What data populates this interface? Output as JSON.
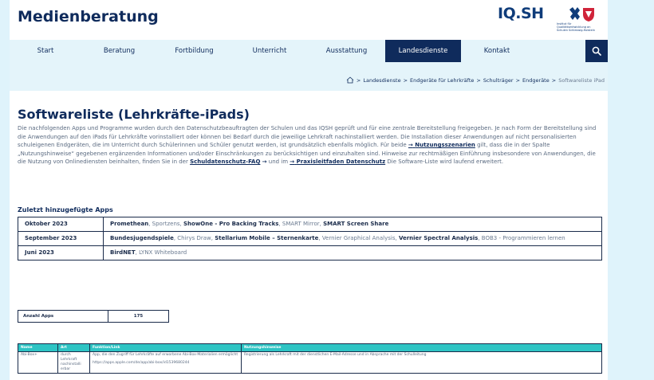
{
  "site": {
    "title": "Medienberatung",
    "logo_text": "IQ.SH",
    "logo_sub": "Institut für Qualitätsentwicklung an Schulen Schleswig-Holstein"
  },
  "nav": {
    "items": [
      {
        "label": "Start",
        "active": false
      },
      {
        "label": "Beratung",
        "active": false
      },
      {
        "label": "Fortbildung",
        "active": false
      },
      {
        "label": "Unterricht",
        "active": false
      },
      {
        "label": "Ausstattung",
        "active": false
      },
      {
        "label": "Landesdienste",
        "active": true
      },
      {
        "label": "Kontakt",
        "active": false
      }
    ],
    "search_icon": "search-icon"
  },
  "breadcrumb": {
    "items": [
      "Landesdienste",
      "Endgeräte für Lehrkräfte",
      "Schulträger",
      "Endgeräte"
    ],
    "current": "Softwareliste iPad",
    "separator": ">"
  },
  "page": {
    "title": "Softwareliste (Lehrkräfte-iPads)",
    "intro_1": "Die nachfolgenden Apps und Programme wurden durch den Datenschutzbeauftragten der Schulen und das IQSH geprüft und für eine zentrale Bereitstellung freigegeben. Je nach Form der Bereitstellung sind die Anwendungen auf den iPads für Lehrkräfte vorinstalliert oder können bei Bedarf durch die jeweilige Lehrkraft nachinstalliert werden. Die Installation dieser Anwendungen auf nicht personalisierten schuleigenen Endgeräten, die im Unterricht durch Schülerinnen und Schüler genutzt werden, ist grundsätzlich ebenfalls möglich. Für beide ",
    "link_1": "Nutzungsszenarien",
    "intro_2": " gilt, dass die in der Spalte „Nutzungshinweise“ gegebenen ergänzenden Informationen und/oder Einschränkungen zu berücksichtigen und einzuhalten sind. Hinweise zur rechtmäßigen Einführung insbesondere von Anwendungen, die die Nutzung von Onlinediensten beinhalten, finden Sie in der ",
    "link_2": "Schuldatenschutz-FAQ",
    "intro_3": " und im ",
    "link_3": "Praxisleitfaden Datenschutz",
    "intro_4": " Die Software-Liste wird laufend erweitert.",
    "link_arrow": "→"
  },
  "recent": {
    "title": "Zuletzt hinzugefügte Apps",
    "rows": [
      {
        "month": "Oktober 2023",
        "apps": [
          {
            "name": "Promethean",
            "bold": true,
            "sep": ", "
          },
          {
            "name": "Sportzens",
            "bold": false,
            "sep": ", "
          },
          {
            "name": "ShowOne - Pro Backing Tracks",
            "bold": true,
            "sep": ", "
          },
          {
            "name": "SMART Mirror",
            "bold": false,
            "sep": ", "
          },
          {
            "name": "SMART Screen Share",
            "bold": true,
            "sep": ""
          }
        ]
      },
      {
        "month": "September 2023",
        "apps": [
          {
            "name": "Bundesjugendspiele",
            "bold": true,
            "sep": ", "
          },
          {
            "name": "Chirys Draw",
            "bold": false,
            "sep": ", "
          },
          {
            "name": "Stellarium Mobile – Sternenkarte",
            "bold": true,
            "sep": ", "
          },
          {
            "name": "Vernier Graphical Analysis",
            "bold": false,
            "sep": ", "
          },
          {
            "name": "Vernier Spectral Analysis",
            "bold": true,
            "sep": ", "
          },
          {
            "name": "BOB3 - Programmieren lernen",
            "bold": false,
            "sep": ""
          }
        ]
      },
      {
        "month": "Juni 2023",
        "apps": [
          {
            "name": "BirdNET",
            "bold": true,
            "sep": ", "
          },
          {
            "name": "LYNX Whiteboard",
            "bold": false,
            "sep": ""
          }
        ]
      }
    ]
  },
  "count": {
    "label": "Anzahl Apps",
    "value": "175"
  },
  "apps_table": {
    "headers": [
      "Name",
      "Art",
      "Funktion/Link",
      "Nutzungshinweise"
    ],
    "rows": [
      {
        "name": "Abi-Box+",
        "art": "durch Lehrkraft nachinstalli erbar",
        "funktion": "App, die den Zugriff für Lehrkräfte auf erworbene Abi-Box-Materialien ermöglicht",
        "link": "https://apps.apple.com/de/app/abi-box/id1539680244",
        "hinweise": "Registrierung als Lehrkraft mit der dienstlichen E-Mail-Adresse und in Absprache mit der Schulleitung"
      }
    ]
  },
  "colors": {
    "primary": "#0f2b5c",
    "nav_bg": "#e4f4fa",
    "page_bg": "#dff3fb",
    "table_header": "#2ec4c4",
    "logo_red": "#d0243a"
  }
}
